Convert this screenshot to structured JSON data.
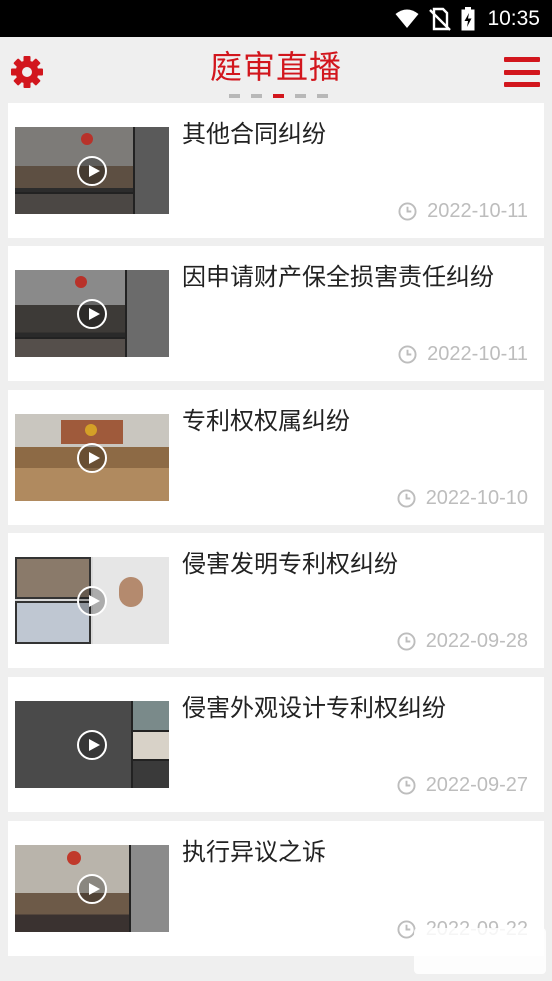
{
  "status_bar": {
    "time": "10:35",
    "icons": [
      "wifi-icon",
      "no-sim-icon",
      "battery-charging-icon"
    ]
  },
  "header": {
    "title": "庭审直播",
    "settings_icon": "gear-icon",
    "menu_icon": "hamburger-menu-icon",
    "page_indicator": {
      "count": 5,
      "active_index": 2
    }
  },
  "colors": {
    "accent": "#d2161d",
    "background": "#efefef",
    "card": "#ffffff",
    "date_text": "#bdbdbd"
  },
  "cases": [
    {
      "title": "其他合同纠纷",
      "date": "2022-10-11",
      "thumbnail": "court-video-thumbnail",
      "icon": "play-icon"
    },
    {
      "title": "因申请财产保全损害责任纠纷",
      "date": "2022-10-11",
      "thumbnail": "court-video-thumbnail",
      "icon": "play-icon"
    },
    {
      "title": "专利权权属纠纷",
      "date": "2022-10-10",
      "thumbnail": "court-video-thumbnail",
      "icon": "play-icon"
    },
    {
      "title": "侵害发明专利权纠纷",
      "date": "2022-09-28",
      "thumbnail": "court-video-thumbnail",
      "icon": "play-icon"
    },
    {
      "title": "侵害外观设计专利权纠纷",
      "date": "2022-09-27",
      "thumbnail": "court-video-thumbnail",
      "icon": "play-icon"
    },
    {
      "title": "执行异议之诉",
      "date": "2022-09-22",
      "thumbnail": "court-video-thumbnail",
      "icon": "play-icon"
    }
  ]
}
